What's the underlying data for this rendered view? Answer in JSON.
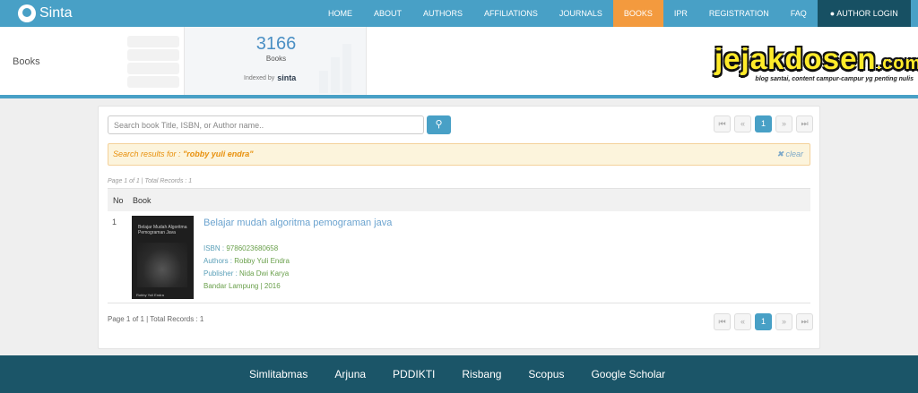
{
  "app": {
    "name": "Sinta"
  },
  "nav": {
    "items": [
      "HOME",
      "ABOUT",
      "AUTHORS",
      "AFFILIATIONS",
      "JOURNALS",
      "BOOKS",
      "IPR",
      "REGISTRATION",
      "FAQ"
    ],
    "active": "BOOKS",
    "login_label": "AUTHOR LOGIN"
  },
  "header": {
    "page_title": "Books",
    "stat_count": "3166",
    "stat_label": "Books",
    "indexed_by": "Indexed by",
    "indexed_logo": "sinta",
    "watermark_main": "jejakdosen",
    "watermark_tld": ".com",
    "watermark_tagline": "blog santai, content campur-campur yg penting nulis"
  },
  "search": {
    "placeholder": "Search book Title, ISBN, or Author name..",
    "value": ""
  },
  "pagination": {
    "first": "⏮",
    "prev": "«",
    "current": "1",
    "next": "»",
    "last": "⏭"
  },
  "alert": {
    "prefix": "Search results for : ",
    "query": "\"robby yuli endra\"",
    "clear_label": "clear"
  },
  "meta_top": "Page 1 of 1 | Total Records : 1",
  "table": {
    "headers": {
      "no": "No",
      "book": "Book"
    },
    "rows": [
      {
        "no": "1",
        "cover_title": "Belajar Mudah Algoritma Pemograman Java",
        "cover_author": "Robby Yuli Endra",
        "title": "Belajar mudah algoritma pemograman java",
        "isbn_label": "ISBN : ",
        "isbn": "9786023680658",
        "authors_label": "Authors : ",
        "authors": "Robby Yuli Endra",
        "publisher_label": "Publisher : ",
        "publisher": "Nida Dwi Karya",
        "place_year": "Bandar Lampung | 2016"
      }
    ]
  },
  "meta_bottom": "Page 1 of 1 | Total Records : 1",
  "footer": {
    "links": [
      "Simlitabmas",
      "Arjuna",
      "PDDIKTI",
      "Risbang",
      "Scopus",
      "Google Scholar"
    ]
  },
  "colors": {
    "nav": "#48a0c6",
    "active": "#f39a3e",
    "login": "#175063",
    "footer": "#1b5568"
  }
}
